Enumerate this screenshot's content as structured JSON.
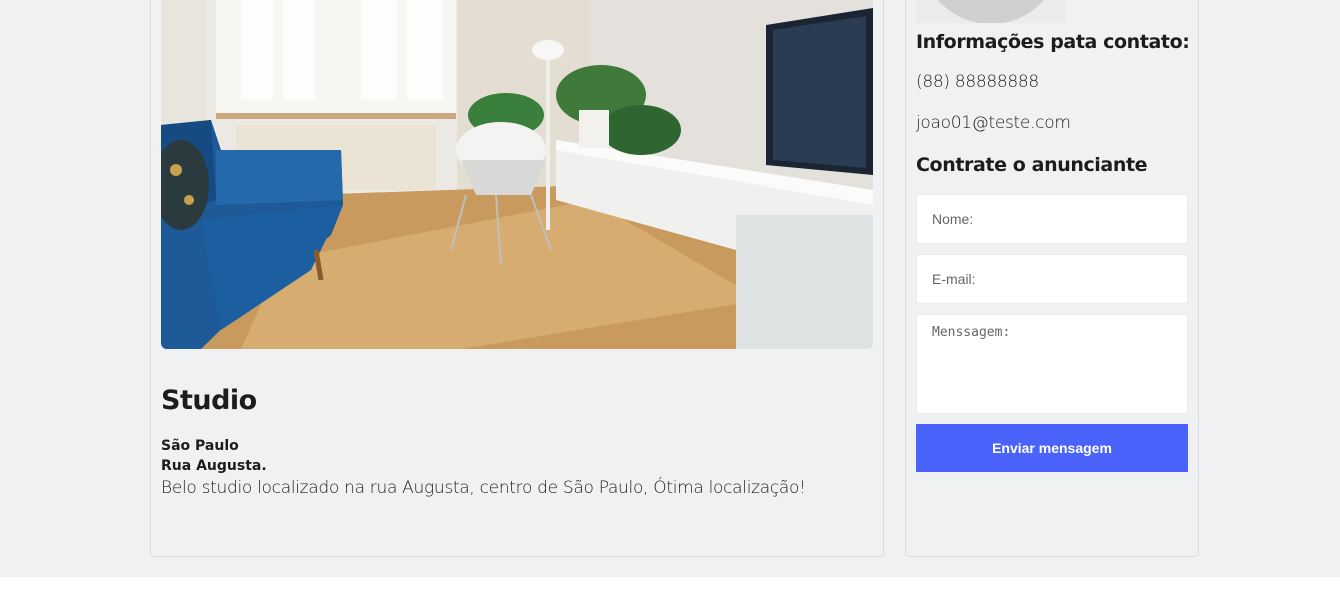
{
  "listing": {
    "photo_alt": "Living room with blue sofa, white chair, plants and TV",
    "title": "Studio",
    "city": "São Paulo",
    "street": "Rua Augusta.",
    "description": "Belo studio localizado na rua Augusta, centro de São Paulo, Ótima localização!"
  },
  "sidebar": {
    "contact_heading": "Informações pata contato:",
    "phone": "(88) 88888888",
    "email": "joao01@teste.com",
    "hire_heading": "Contrate o anunciante",
    "form": {
      "name_placeholder": "Nome:",
      "email_placeholder": "E-mail:",
      "message_placeholder": "Menssagem:",
      "submit_label": "Enviar mensagem"
    }
  },
  "colors": {
    "accent": "#4a64fb",
    "background": "#f0f1f3"
  }
}
